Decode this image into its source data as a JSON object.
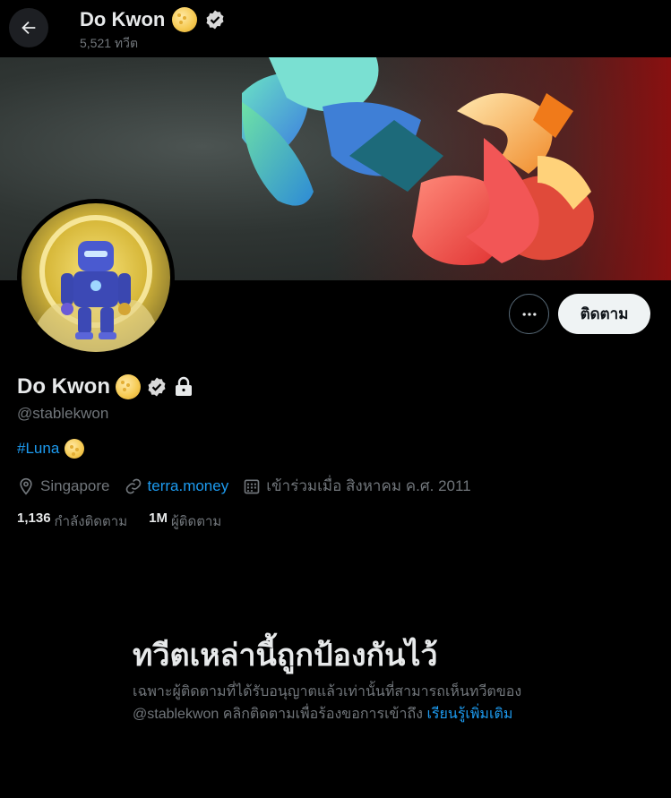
{
  "header": {
    "name": "Do Kwon",
    "tweet_count": "5,521 ทวีต"
  },
  "profile": {
    "display_name": "Do Kwon",
    "handle": "@stablekwon",
    "bio_link": "#Luna",
    "location": "Singapore",
    "website": "terra.money",
    "joined": "เข้าร่วมเมื่อ สิงหาคม ค.ศ. 2011",
    "following_count": "1,136",
    "following_label": "กำลังติดตาม",
    "followers_count": "1M",
    "followers_label": "ผู้ติดตาม"
  },
  "actions": {
    "follow_label": "ติดตาม"
  },
  "protected": {
    "title": "ทวีตเหล่านี้ถูกป้องกันไว้",
    "body": "เฉพาะผู้ติดตามที่ได้รับอนุญาตแล้วเท่านั้นที่สามารถเห็นทวีตของ @stablekwon คลิกติดตามเพื่อร้องขอการเข้าถึง",
    "learn_more": "เรียนรู้เพิ่มเติม"
  },
  "colors": {
    "accent": "#1d9bf0",
    "background": "#000000",
    "secondary_text": "#71767b"
  },
  "icons": [
    "back-arrow-icon",
    "moon-emoji-icon",
    "verified-badge-icon",
    "lock-icon",
    "more-icon",
    "location-icon",
    "link-icon",
    "calendar-icon"
  ]
}
